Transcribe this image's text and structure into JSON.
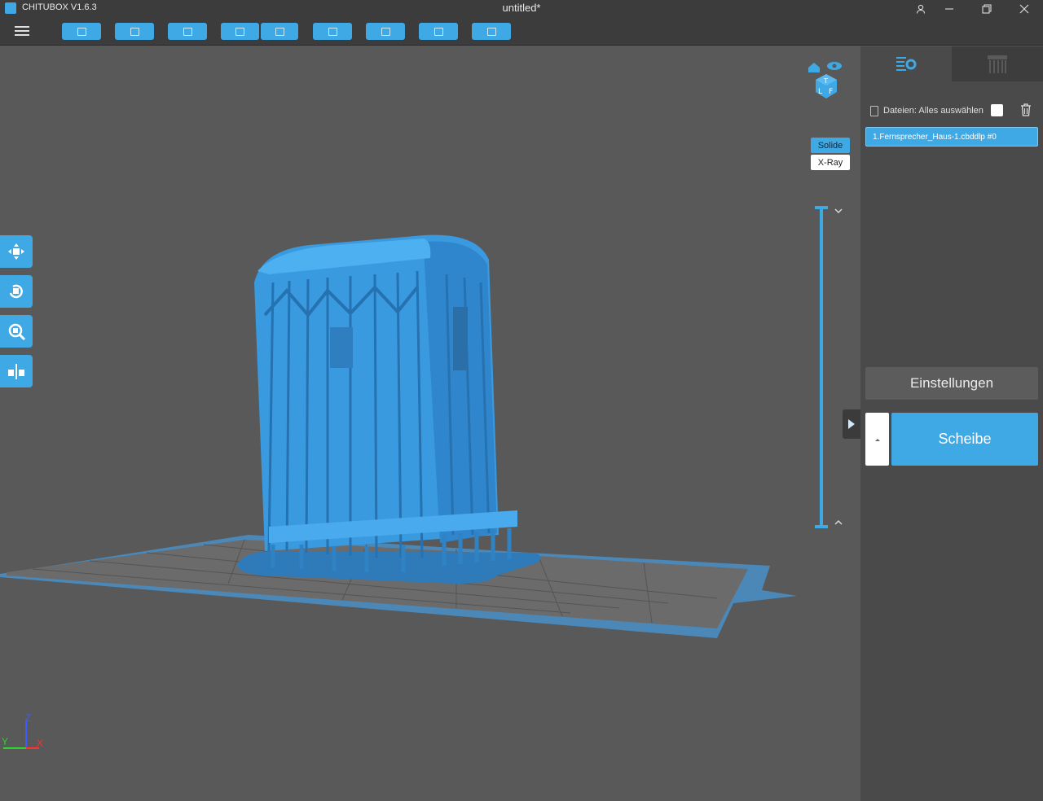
{
  "titlebar": {
    "app_name": "CHITUBOX V1.6.3",
    "document_title": "untitled*"
  },
  "toolbar": {
    "buttons": [
      "open-file-icon",
      "save-icon",
      "screenshot-icon",
      "undo-icon",
      "redo-icon",
      "job-settings-icon",
      "supports-icon",
      "hollow-icon",
      "machine-icon"
    ]
  },
  "viewport": {
    "render_modes": {
      "solid": "Solide",
      "xray": "X-Ray"
    },
    "axes": {
      "z": "Z",
      "y": "Y",
      "x": "X"
    },
    "left_tools": [
      "move-icon",
      "rotate-icon",
      "scale-icon",
      "mirror-icon"
    ]
  },
  "right_panel": {
    "files_label": "Dateien: Alles auswählen",
    "files": [
      "1.Fernsprecher_Haus-1.cbddlp #0"
    ],
    "settings_label": "Einstellungen",
    "slice_label": "Scheibe"
  },
  "colors": {
    "accent": "#3fa9e6",
    "panel": "#4a4a4a",
    "viewport": "#595959",
    "bar": "#3c3c3c"
  }
}
